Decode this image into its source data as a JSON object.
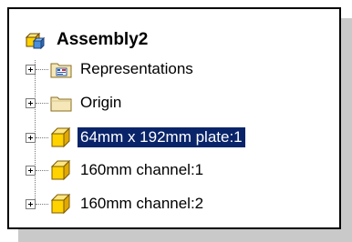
{
  "tree": {
    "root": {
      "label": "Assembly2",
      "icon": "assembly-icon"
    },
    "nodes": [
      {
        "label": "Representations",
        "icon": "representations-folder-icon",
        "selected": false
      },
      {
        "label": "Origin",
        "icon": "folder-icon",
        "selected": false
      },
      {
        "label": "64mm x 192mm plate:1",
        "icon": "part-icon",
        "selected": true
      },
      {
        "label": "160mm channel:1",
        "icon": "part-icon",
        "selected": false
      },
      {
        "label": "160mm channel:2",
        "icon": "part-icon",
        "selected": false
      }
    ]
  },
  "colors": {
    "selection_bg": "#0a246a",
    "selection_text": "#ffffff",
    "part_icon_fill": "#ffd200",
    "folder_fill": "#f5e7b8",
    "panel_shadow": "#c9c9c9"
  }
}
